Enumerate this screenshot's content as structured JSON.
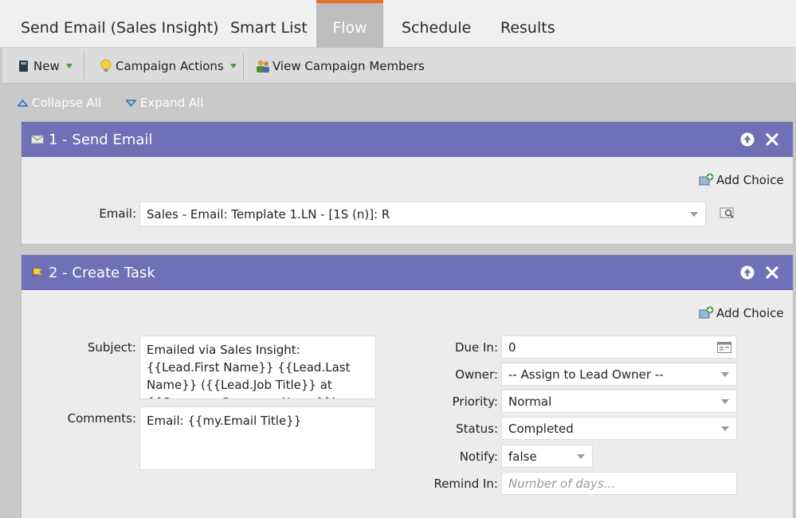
{
  "tabs": [
    {
      "label": "Send Email (Sales Insight)",
      "active": false
    },
    {
      "label": "Smart List",
      "active": false
    },
    {
      "label": "Flow",
      "active": true
    },
    {
      "label": "Schedule",
      "active": false
    },
    {
      "label": "Results",
      "active": false
    }
  ],
  "toolbar": {
    "new_label": "New",
    "campaign_actions_label": "Campaign Actions",
    "view_members_label": "View Campaign Members"
  },
  "flow_controls": {
    "collapse_all": "Collapse All",
    "expand_all": "Expand All"
  },
  "steps": [
    {
      "title": "1 - Send Email",
      "add_choice": "Add Choice",
      "email_label": "Email:",
      "email_value": "Sales - Email: Template 1.LN - [1S (n)]: R"
    },
    {
      "title": "2 - Create Task",
      "add_choice": "Add Choice",
      "subject_label": "Subject:",
      "subject_value": "Emailed via Sales Insight: {{Lead.First Name}} {{Lead.Last Name}} ({{Lead.Job Title}} at {{Company.Company Name}})",
      "comments_label": "Comments:",
      "comments_value": "Email: {{my.Email Title}}",
      "due_in_label": "Due In:",
      "due_in_value": "0",
      "owner_label": "Owner:",
      "owner_value": "-- Assign to Lead Owner --",
      "priority_label": "Priority:",
      "priority_value": "Normal",
      "status_label": "Status:",
      "status_value": "Completed",
      "notify_label": "Notify:",
      "notify_value": "false",
      "remind_in_label": "Remind In:",
      "remind_in_placeholder": "Number of days..."
    }
  ],
  "colors": {
    "step_header": "#6f70b5",
    "active_tab_accent": "#e8702a",
    "active_tab_bg": "#bdbdbd"
  }
}
